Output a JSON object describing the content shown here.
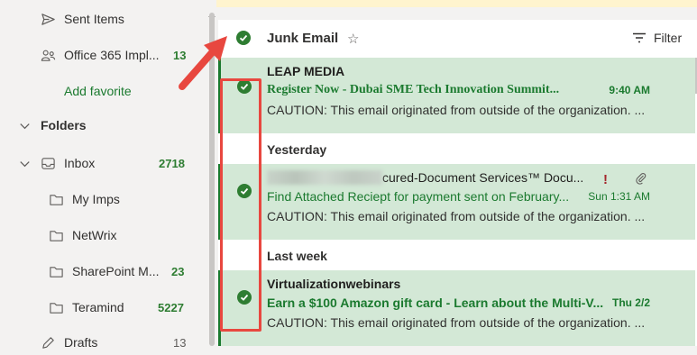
{
  "sidebar": {
    "items": [
      {
        "label": "Sent Items",
        "count": "",
        "icon": "send-icon"
      },
      {
        "label": "Office 365 Impl...",
        "count": "13",
        "icon": "group-icon"
      },
      {
        "label": "Add favorite",
        "count": "",
        "icon": ""
      },
      {
        "label": "Folders",
        "count": "",
        "icon": "chevron-down-icon"
      },
      {
        "label": "Inbox",
        "count": "2718",
        "icon": "inbox-icon"
      },
      {
        "label": "My Imps",
        "count": "",
        "icon": "folder-icon"
      },
      {
        "label": "NetWrix",
        "count": "",
        "icon": "folder-icon"
      },
      {
        "label": "SharePoint M...",
        "count": "23",
        "icon": "folder-icon"
      },
      {
        "label": "Teramind",
        "count": "5227",
        "icon": "folder-icon"
      },
      {
        "label": "Drafts",
        "count": "13",
        "icon": "drafts-icon"
      }
    ]
  },
  "header": {
    "title": "Junk Email",
    "filter_label": "Filter"
  },
  "groups": {
    "yesterday": "Yesterday",
    "last_week": "Last week"
  },
  "messages": [
    {
      "sender": "LEAP MEDIA",
      "subject": "Register Now - Dubai SME Tech Innovation Summit...",
      "time": "9:40 AM",
      "preview": "CAUTION: This email originated from outside of the organization. ..."
    },
    {
      "sender": "cured-Document Services™ Docu...",
      "subject": "Find Attached Reciept for payment sent on February...",
      "time": "Sun 1:31 AM",
      "preview": "CAUTION: This email originated from outside of the organization. ..."
    },
    {
      "sender": "Virtualizationwebinars",
      "subject": "Earn a $100 Amazon gift card - Learn about the Multi-V...",
      "time": "Thu 2/2",
      "preview": "CAUTION: This email originated from outside of the organization. ..."
    }
  ],
  "colors": {
    "accent": "#1b7a2f",
    "selected_bg": "#d3e8d6",
    "annotation": "#e8473f"
  }
}
